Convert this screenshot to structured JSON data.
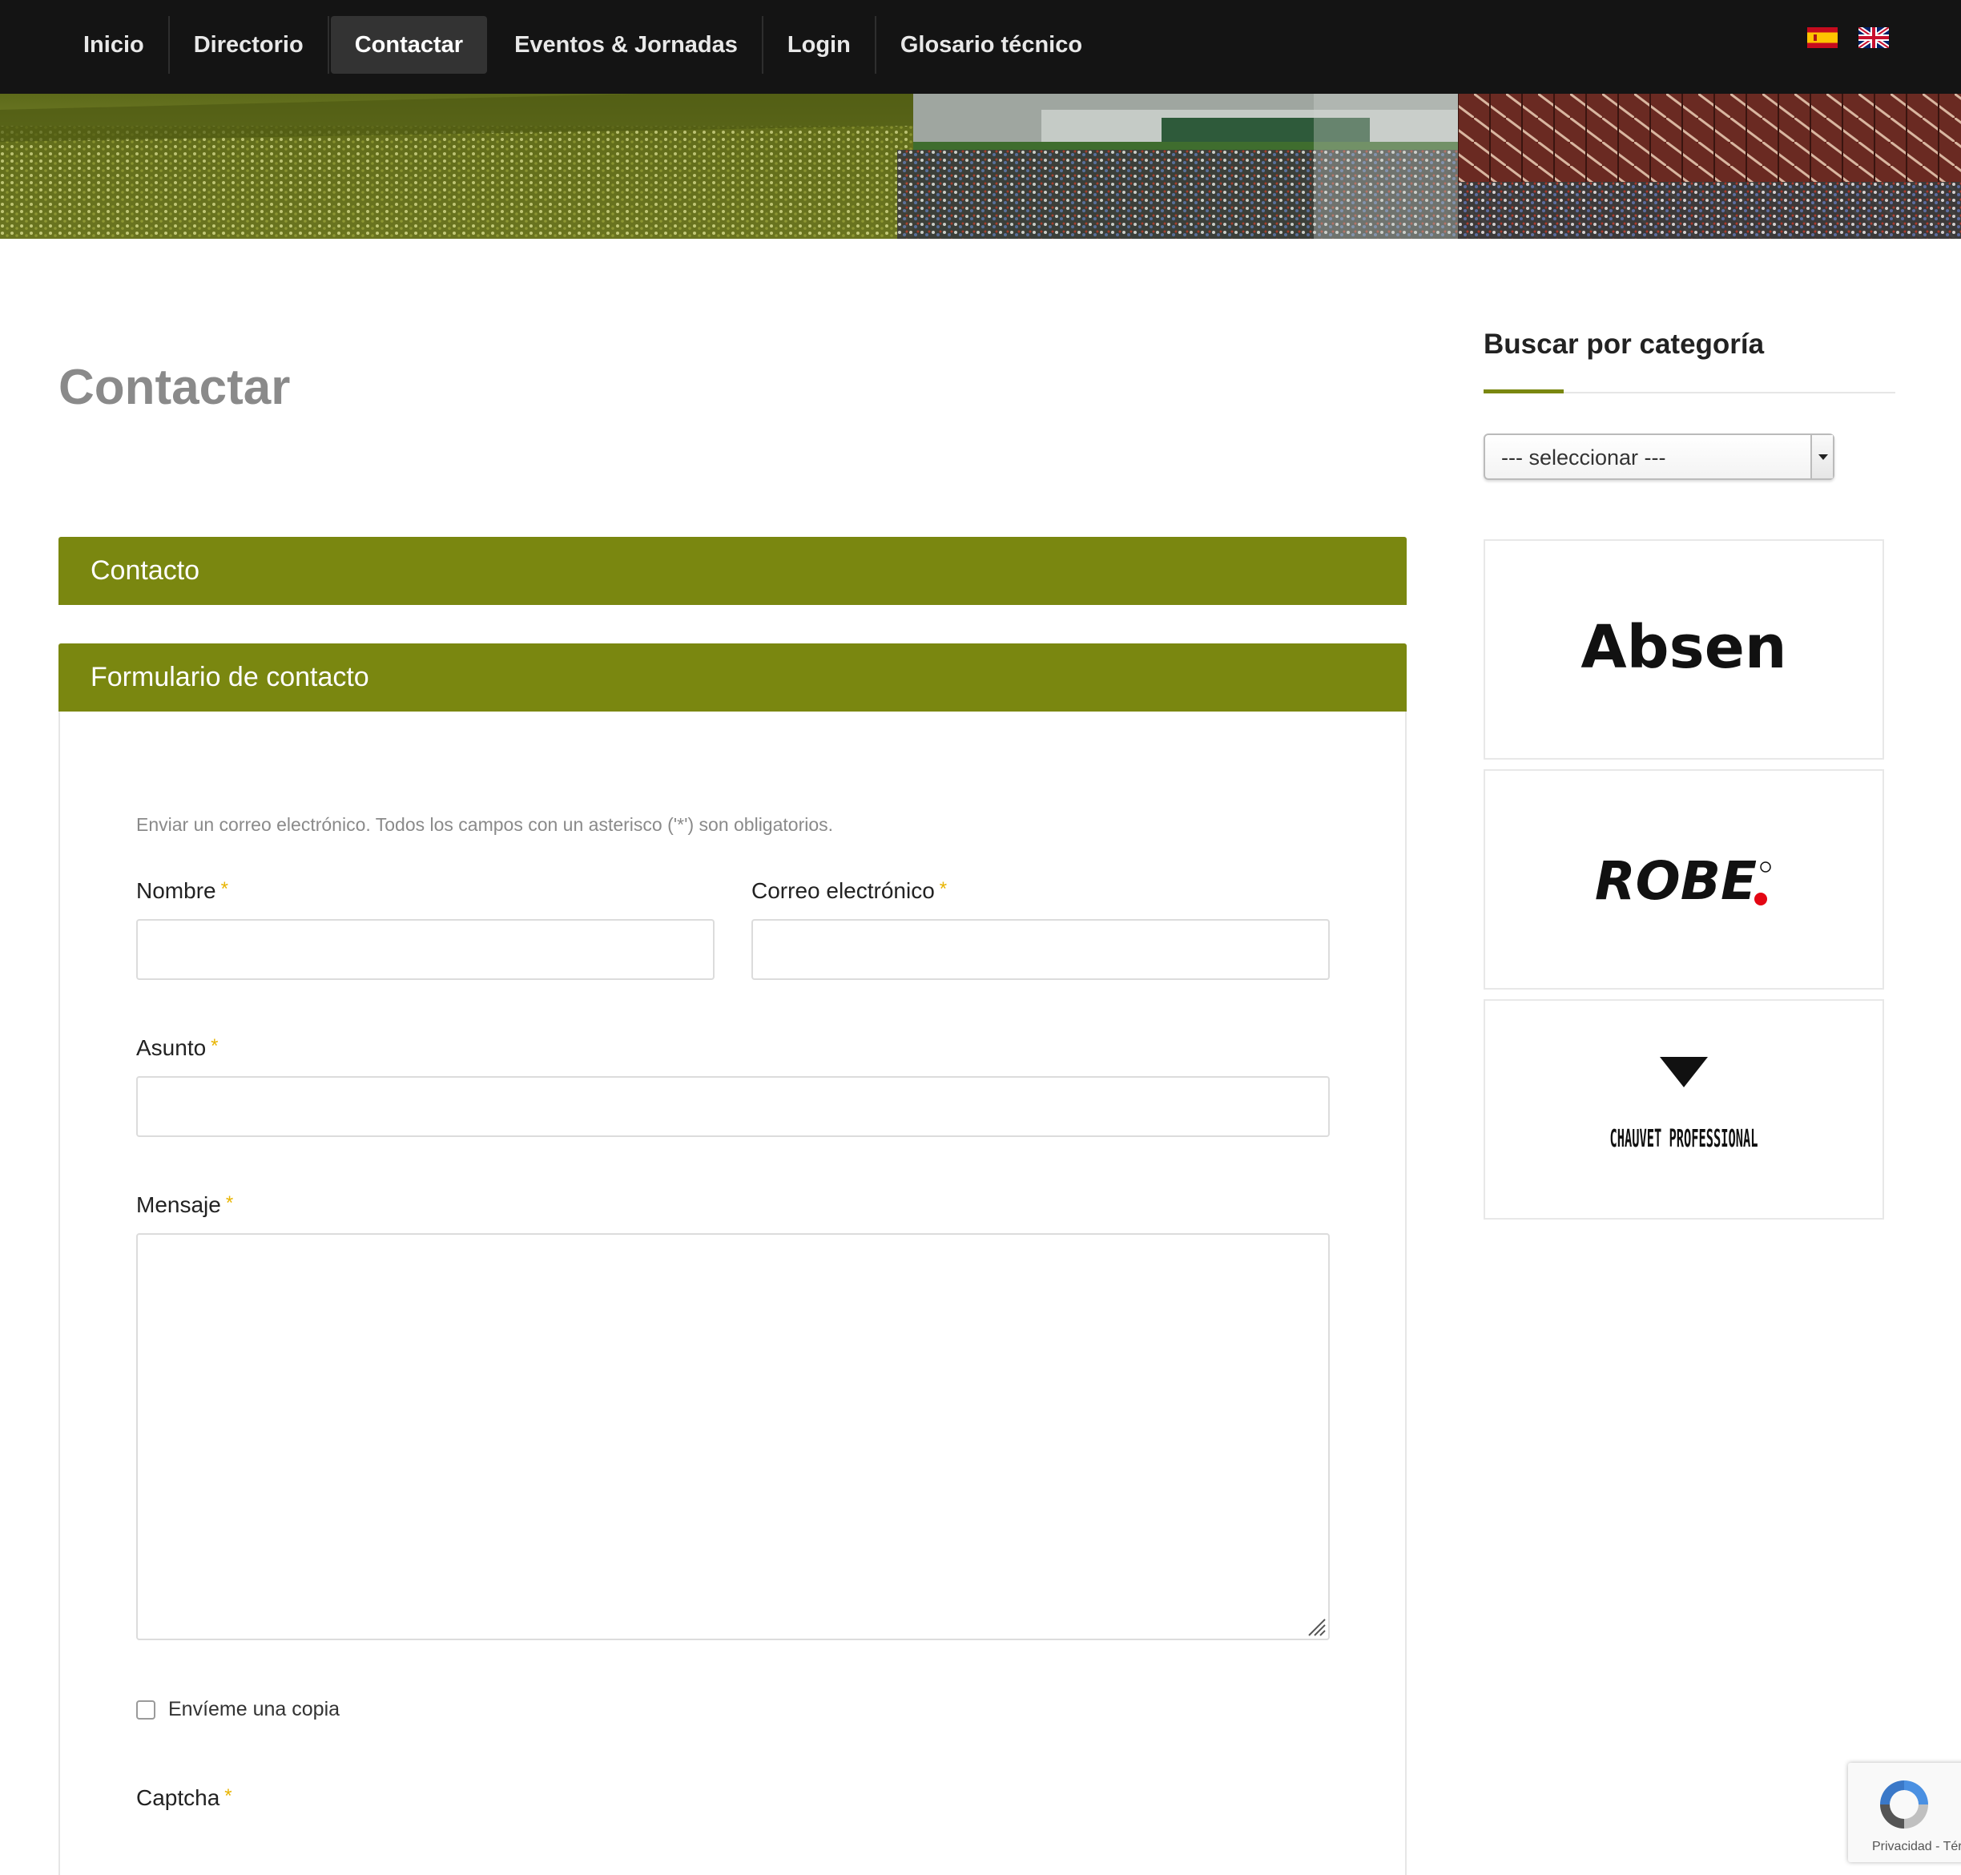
{
  "nav": {
    "items": [
      {
        "label": "Inicio"
      },
      {
        "label": "Directorio"
      },
      {
        "label": "Contactar"
      },
      {
        "label": "Eventos & Jornadas"
      },
      {
        "label": "Login"
      },
      {
        "label": "Glosario técnico"
      }
    ],
    "active": "Contactar",
    "languages": [
      "spanish-flag-icon",
      "uk-flag-icon"
    ]
  },
  "page": {
    "title": "Contactar"
  },
  "contact": {
    "section_title": "Contacto",
    "form_title": "Formulario de contacto",
    "intro": "Enviar un correo electrónico. Todos los campos con un asterisco ('*') son obligatorios.",
    "required_marker": "*",
    "fields": {
      "name_label": "Nombre",
      "email_label": "Correo electrónico",
      "subject_label": "Asunto",
      "message_label": "Mensaje",
      "copy_label": "Envíeme una copia",
      "captcha_label": "Captcha"
    }
  },
  "sidebar": {
    "title": "Buscar por categoría",
    "select_value": "--- seleccionar ---",
    "brands": [
      "Absen",
      "ROBE",
      "CHAUVET PROFESSIONAL"
    ]
  },
  "recaptcha": {
    "text": "Privacidad - Términos"
  },
  "colors": {
    "accent": "#7a8710",
    "nav_bg": "#141414",
    "required": "#e8b400"
  }
}
